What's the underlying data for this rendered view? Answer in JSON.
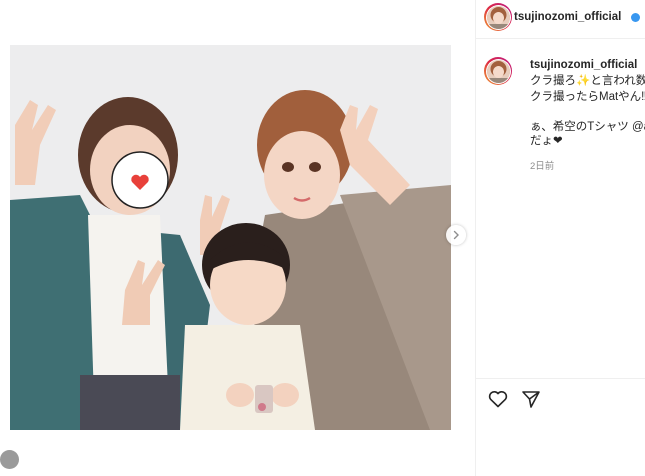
{
  "post": {
    "photo_alt": "",
    "next_arrow": "chevron-right-icon"
  },
  "header": {
    "username": "tsujinozomi_official",
    "verified": true
  },
  "caption": {
    "username": "tsujinozomi_official",
    "lines": [
      "クラ撮ろ✨と言われ数",
      "クラ撮ったらMatやん‼",
      "ぁ、希空のTシャツ @a",
      "だょ❤"
    ],
    "time": "2日前"
  },
  "actions": {
    "like_icon": "heart-outline-icon",
    "share_icon": "paper-plane-icon"
  },
  "colors": {
    "accent_blue": "#3897f0",
    "text": "#262626",
    "muted": "#8e8e8e",
    "heart_red": "#e8403a"
  }
}
